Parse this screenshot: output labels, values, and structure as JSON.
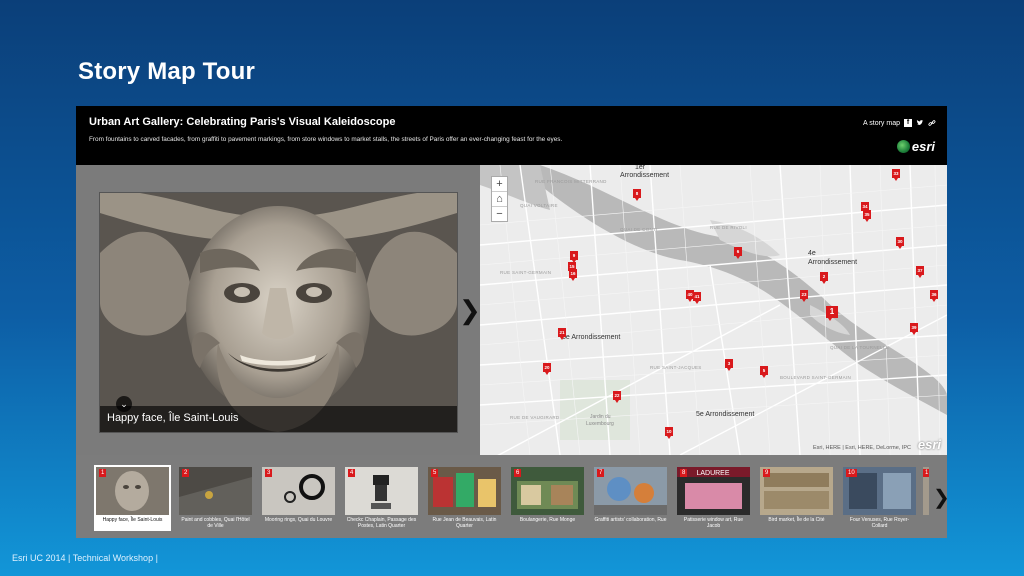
{
  "slide": {
    "title": "Story Map Tour",
    "footer": "Esri UC 2014 | Technical Workshop |"
  },
  "app": {
    "title": "Urban Art Gallery: Celebrating Paris's Visual Kaleidoscope",
    "subtitle": "From fountains to carved facades, from graffiti to pavement markings, from store windows to market stalls, the streets of Paris offer an ever-changing feast for the eyes.",
    "share_label": "A story map",
    "logo_text": "esri"
  },
  "media": {
    "caption": "Happy face, Île Saint-Louis"
  },
  "map": {
    "labels": {
      "arr1_top": "1er",
      "arr1_bottom": "Arrondissement",
      "arr4_top": "4e",
      "arr4_bottom": "Arrondissement",
      "arr6": "6e Arrondissement",
      "arr5": "5e Arrondissement",
      "jardin_top": "Jardin du",
      "jardin_bottom": "Luxembourg"
    },
    "streets": [
      "RUE FRANCOIS MITTERRAND",
      "QUAI VOLTAIRE",
      "QUAI DE CONTI",
      "RUE DE RIVOLI",
      "RUE SAINT-GERMAIN",
      "BOULEVARD SAINT-GERMAIN",
      "RUE SAINT-JACQUES",
      "QUAI DE LA TOURNELLE",
      "RUE DE VAUGIRARD"
    ],
    "attribution": "Esri, HERE | Esri, HERE, DeLorme, IPC",
    "logo_text": "esri",
    "zoom": {
      "in": "+",
      "home": "⌂",
      "out": "−"
    }
  },
  "carousel": {
    "items": [
      {
        "num": "1",
        "label": "Happy face, Île Saint-Louis"
      },
      {
        "num": "2",
        "label": "Paint and cobbles, Quai l'Hôtel de Ville"
      },
      {
        "num": "3",
        "label": "Mooring rings, Quai du Louvre"
      },
      {
        "num": "4",
        "label": "Checkc Chaplain, Passage des Postes, Latin Quarter"
      },
      {
        "num": "5",
        "label": "Rue Jean de Beauvais, Latin Quarter"
      },
      {
        "num": "6",
        "label": "Boulangerie, Rue Monge"
      },
      {
        "num": "7",
        "label": "Graffiti artists' collaboration, Rue"
      },
      {
        "num": "8",
        "label": "Patisserie window art, Rue Jacob"
      },
      {
        "num": "9",
        "label": "Bird market, Île de la Cité"
      },
      {
        "num": "10",
        "label": "Four Venuses, Rue Royer-Collard"
      },
      {
        "num": "1"
      }
    ]
  },
  "colors": {
    "marker": "#d9191c",
    "header": "#000000"
  }
}
